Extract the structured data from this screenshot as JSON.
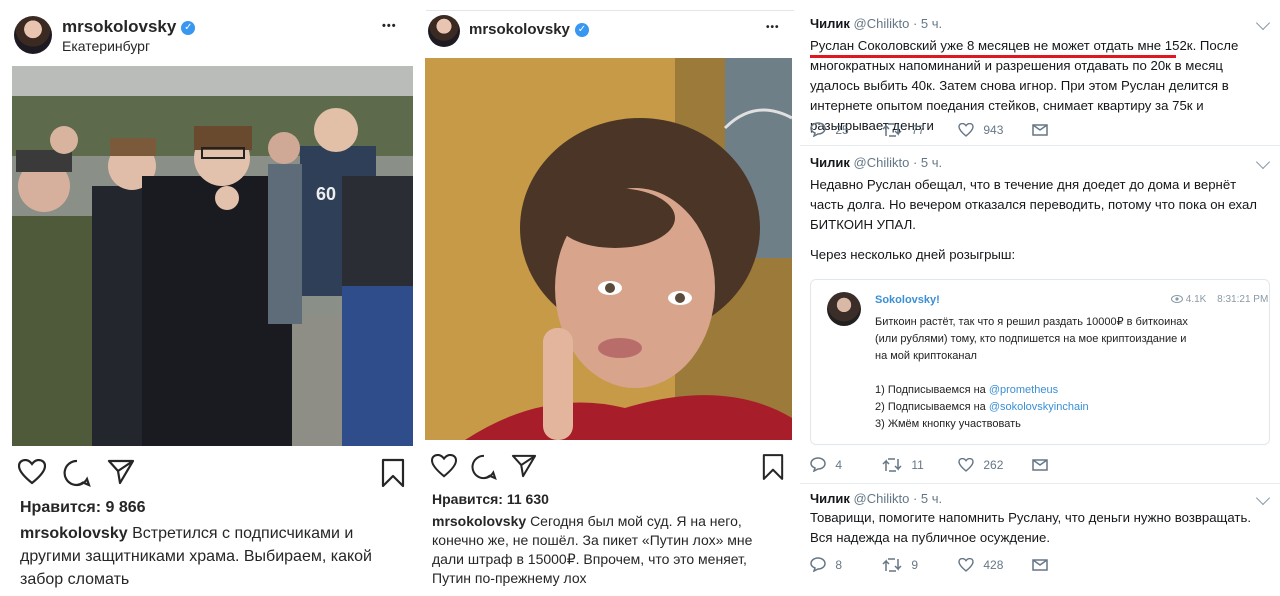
{
  "post1": {
    "username": "mrsokolovsky",
    "verified": true,
    "location": "Екатеринбург",
    "more": "•••",
    "likes": "Нравится: 9 866",
    "caption_user": "mrsokolovsky",
    "caption_text": "Встретился с подписчиками и другими защитниками храма. Выбираем, какой забор сломать",
    "jersey_number": "60"
  },
  "post2": {
    "username": "mrsokolovsky",
    "verified": true,
    "more": "•••",
    "likes": "Нравится: 11 630",
    "caption_user": "mrsokolovsky",
    "caption_text": "Сегодня был мой суд. Я на него, конечно же, не пошёл. За пикет «Путин лох» мне дали штраф в 15000₽. Впрочем, что это меняет, Путин по-прежнему лох"
  },
  "tweets": [
    {
      "name": "Чилик",
      "handle": "@Chilikto",
      "time": "· 5 ч.",
      "text": "Руслан Соколовский уже 8 месяцев не может отдать мне 152к. После многократных напоминаний и разрешения отдавать по 20к в месяц удалось выбить 40к. Затем снова игнор. При этом Руслан делится в интернете опытом поедания стейков, снимает квартиру за 75к и разыгрывает деньги",
      "replies": "25",
      "retweets": "77",
      "likes": "943"
    },
    {
      "name": "Чилик",
      "handle": "@Chilikto",
      "time": "· 5 ч.",
      "text": "Недавно Руслан обещал, что в течение дня доедет до дома и вернёт часть долга. Но вечером отказался переводить, потому что пока он ехал БИТКОИН УПАЛ.",
      "text2": "Через несколько дней розыгрыш:",
      "replies": "4",
      "retweets": "11",
      "likes": "262"
    },
    {
      "name": "Чилик",
      "handle": "@Chilikto",
      "time": "· 5 ч.",
      "text": "Товарищи, помогите напомнить Руслану, что деньги нужно возвращать. Вся надежда на публичное осуждение.",
      "replies": "8",
      "retweets": "9",
      "likes": "428"
    }
  ],
  "card": {
    "name": "Sokolovsky!",
    "views": "4.1K",
    "time": "8:31:21 PM",
    "line1": "Биткоин растёт, так что я решил раздать 10000₽ в биткоинах",
    "line2": "(или рублями) тому, кто подпишется на мое криптоиздание и",
    "line3": "на мой криптоканал",
    "step1_prefix": "1) Подписываемся на ",
    "step1_link": "@prometheus",
    "step2_prefix": "2) Подписываемся на ",
    "step2_link": "@sokolovskyinchain",
    "step3": "3) Жмём кнопку участвовать"
  },
  "colors": {
    "accent_red": "#e0171f",
    "twitter_gray": "#657786",
    "ig_verified": "#3897f0"
  }
}
